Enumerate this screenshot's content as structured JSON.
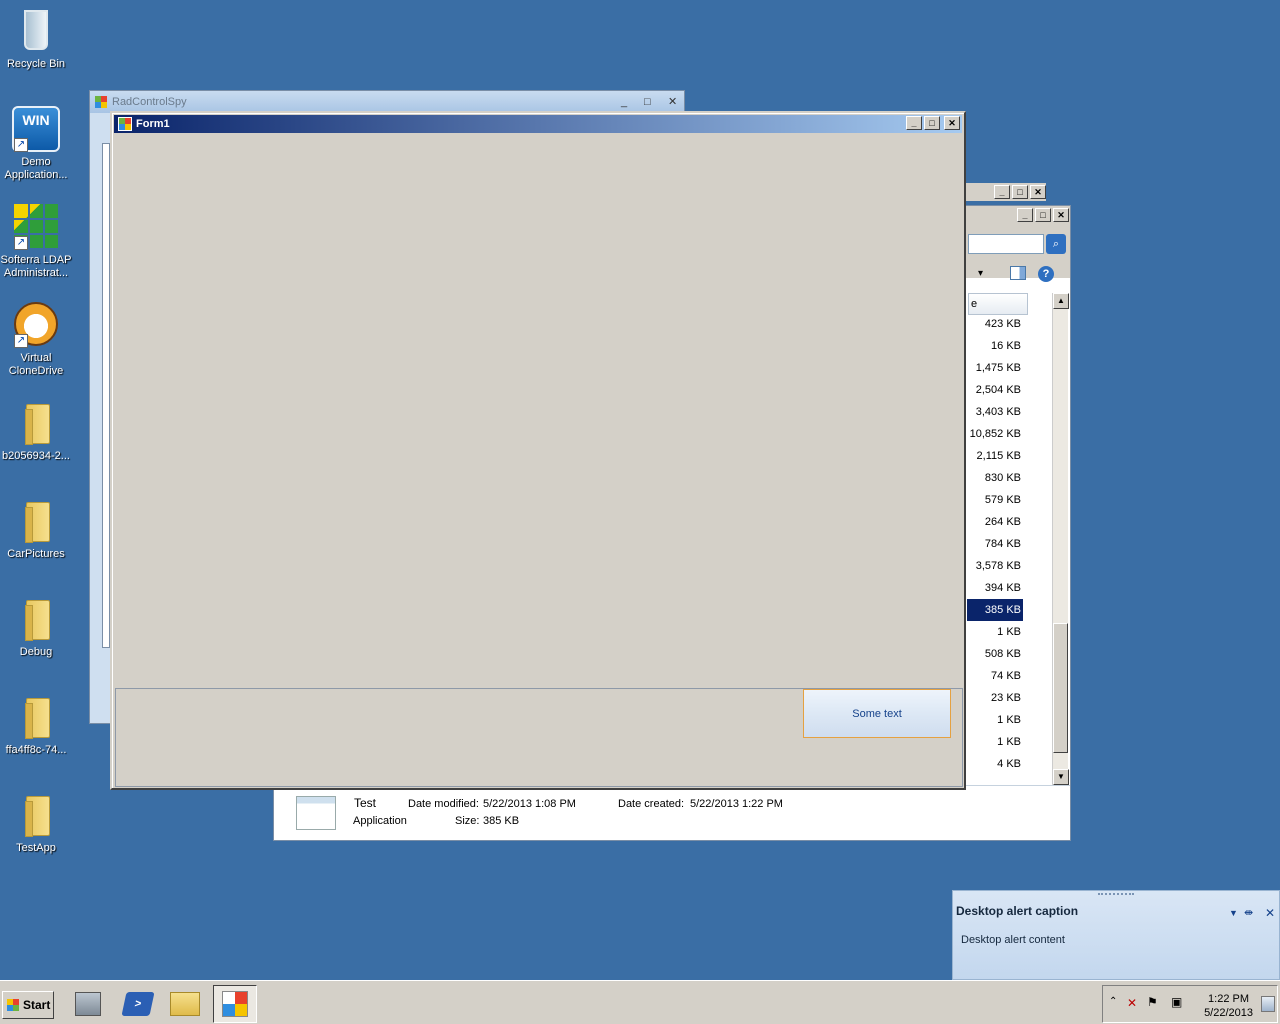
{
  "desktop": {
    "icons": [
      {
        "label": "Recycle Bin",
        "icon": "recycle-bin-icon"
      },
      {
        "label": "Demo Application...",
        "icon": "win-demo-icon",
        "badge": "WIN"
      },
      {
        "label": "Softerra LDAP Administrat...",
        "icon": "ldap-admin-icon"
      },
      {
        "label": "Virtual CloneDrive",
        "icon": "clonedrive-icon"
      },
      {
        "label": "b2056934-2...",
        "icon": "folder-icon"
      },
      {
        "label": "CarPictures",
        "icon": "folder-icon"
      },
      {
        "label": "Debug",
        "icon": "folder-icon"
      },
      {
        "label": "ffa4ff8c-74...",
        "icon": "folder-icon"
      },
      {
        "label": "TestApp",
        "icon": "folder-icon"
      }
    ]
  },
  "radcontrolspy": {
    "title": "RadControlSpy",
    "controls": {
      "minimize": "_",
      "maximize": "□",
      "close": "✕"
    }
  },
  "form1": {
    "title": "Form1",
    "controls": {
      "minimize": "_",
      "maximize": "□",
      "close": "✕"
    },
    "button_label": "Some text"
  },
  "explorer": {
    "sizes": [
      "423 KB",
      "16 KB",
      "1,475 KB",
      "2,504 KB",
      "3,403 KB",
      "10,852 KB",
      "2,115 KB",
      "830 KB",
      "579 KB",
      "264 KB",
      "784 KB",
      "3,578 KB",
      "394 KB",
      "385 KB",
      "1 KB",
      "508 KB",
      "74 KB",
      "23 KB",
      "1 KB",
      "1 KB",
      "4 KB"
    ],
    "selected_index": 13,
    "header_fragment": "e",
    "details": {
      "name": "Test",
      "type": "Application",
      "date_modified_label": "Date modified:",
      "date_modified": "5/22/2013 1:08 PM",
      "size_label": "Size:",
      "size": "385 KB",
      "date_created_label": "Date created:",
      "date_created": "5/22/2013 1:22 PM"
    }
  },
  "alert": {
    "caption": "Desktop alert caption",
    "content": "Desktop alert content"
  },
  "taskbar": {
    "start_label": "Start",
    "clock_time": "1:22 PM",
    "clock_date": "5/22/2013"
  }
}
